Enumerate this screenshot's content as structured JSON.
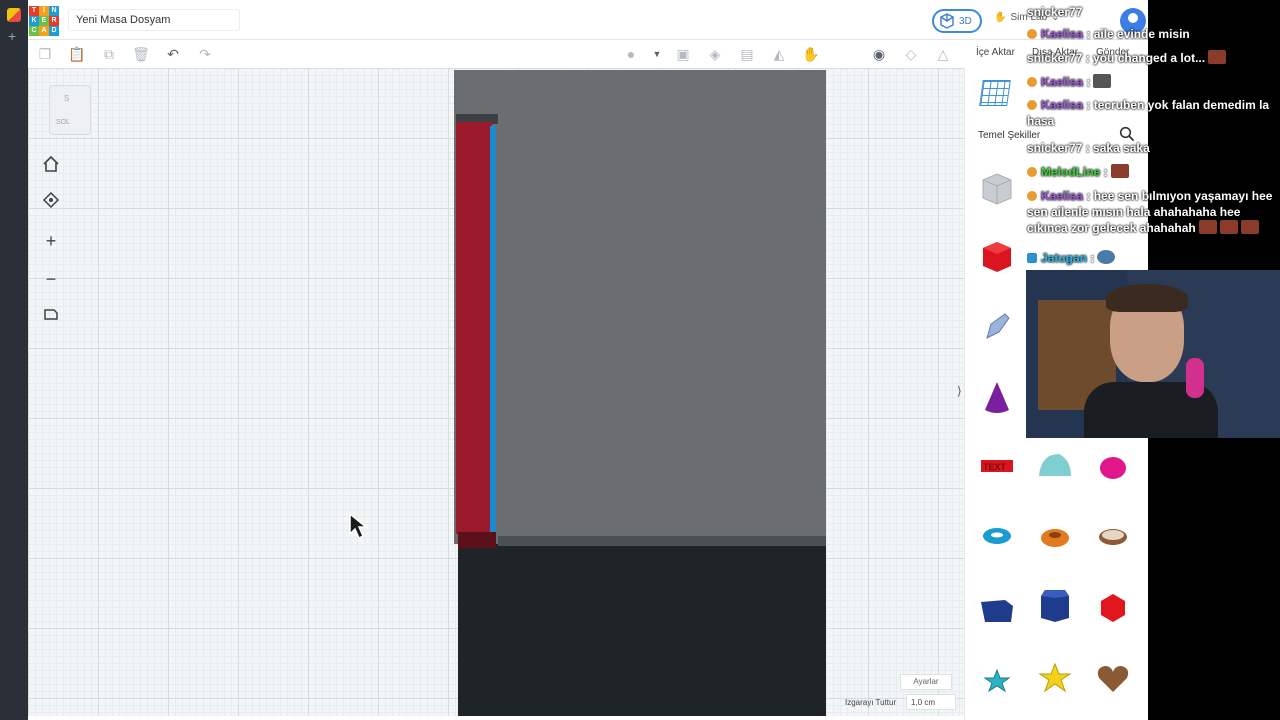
{
  "app": {
    "logo_letters": [
      "T",
      "I",
      "N",
      "K",
      "E",
      "R",
      "C",
      "A",
      "D"
    ],
    "project_name": "Yeni Masa Dosyam",
    "view_mode": "3D",
    "sim_lab": "Sim Lab",
    "chevron": "⌄"
  },
  "toolbar": {
    "import": "İçe Aktar",
    "export": "Dışa Aktar",
    "send": "Gönder"
  },
  "workplane": {
    "viewcube_top": "S",
    "viewcube_face": "SOL",
    "settings": "Ayarlar",
    "snap_label": "Izgarayı Tuttur",
    "snap_value": "1,0 cm"
  },
  "panel": {
    "category": "Temel Şekiller",
    "collapse_glyph": "⟩",
    "shapes": [
      {
        "name": "box-hole",
        "color": "#c8cdd2"
      },
      {
        "name": "box",
        "color": "#d9161f"
      },
      {
        "name": "scribble",
        "color": "#9bb4dc"
      },
      {
        "name": "cone",
        "color": "#7a1f9f"
      },
      {
        "name": "text",
        "color": "#d9161f"
      },
      {
        "name": "half-sphere",
        "color": "#7fcfd0"
      },
      {
        "name": "paraboloid",
        "color": "#e0168a"
      },
      {
        "name": "torus",
        "color": "#1a9bd1"
      },
      {
        "name": "tube",
        "color": "#e47a1f"
      },
      {
        "name": "ring",
        "color": "#8a5a3a"
      },
      {
        "name": "wedge",
        "color": "#1f3b8c"
      },
      {
        "name": "hexagonal-prism",
        "color": "#1f3b8c"
      },
      {
        "name": "polyhedron",
        "color": "#e2161f"
      },
      {
        "name": "star",
        "color": "#2bb3c5"
      },
      {
        "name": "star-yellow",
        "color": "#f2d21a"
      },
      {
        "name": "heart",
        "color": "#8a5a34"
      }
    ]
  },
  "chat": [
    {
      "user": "snicker77",
      "msg": "",
      "color": "#ffffff",
      "badge": ""
    },
    {
      "user": "Kaelisa",
      "msg": " : aile evinde misin",
      "color": "#9b59d6",
      "badge": "#e89b2f"
    },
    {
      "user": "snicker77",
      "msg": " : you changed a lot...",
      "color": "#ffffff",
      "badge": ""
    },
    {
      "user": "Kaelisa",
      "msg": " :",
      "color": "#9b59d6",
      "badge": "#e89b2f"
    },
    {
      "user": "Kaelisa",
      "msg": " : tecruben yok falan demedim la hasa",
      "color": "#9b59d6",
      "badge": "#e89b2f"
    },
    {
      "user": "snicker77",
      "msg": " : saka saka",
      "color": "#ffffff",
      "badge": ""
    },
    {
      "user": "MelodLine",
      "msg": " :",
      "color": "#3fce3f",
      "badge": "#e89b2f"
    },
    {
      "user": "Kaelisa",
      "msg": " : hee sen bılmıyon yaşamayı hee sen ailenle mısın hala ahahahaha hee cıkınca zor gelecek ahahahah",
      "color": "#9b59d6",
      "badge": "#e89b2f"
    },
    {
      "user": "Jatugan",
      "msg": " :",
      "color": "#2bb3e0",
      "badge": "#2b8fd0"
    }
  ]
}
